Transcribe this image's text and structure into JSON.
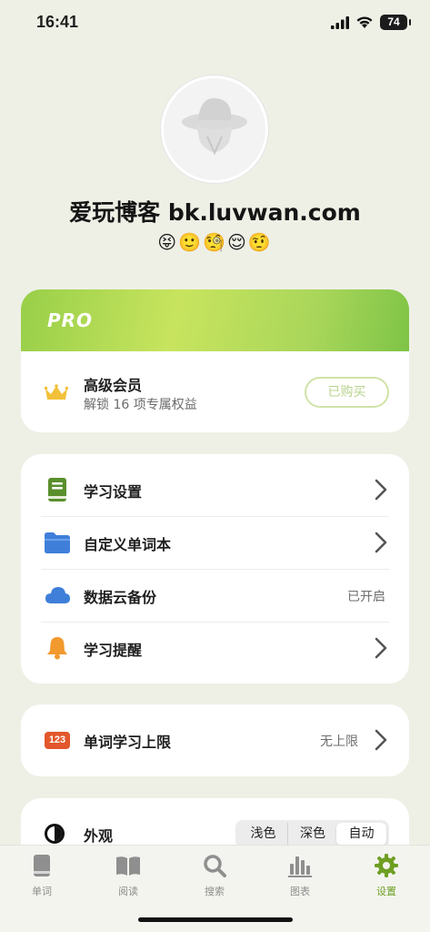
{
  "status_bar": {
    "time": "16:41",
    "battery": "74"
  },
  "profile": {
    "username": "爱玩博客 bk.luvwan.com",
    "emojis": "😝🙂🧐😌🤨"
  },
  "pro": {
    "label": "PRO",
    "member_title": "高级会员",
    "member_subtitle": "解锁 16 项专属权益",
    "bought_button": "已购买"
  },
  "settings": {
    "items": [
      {
        "label": "学习设置",
        "icon": "book-icon",
        "value": "",
        "chevron": true
      },
      {
        "label": "自定义单词本",
        "icon": "folder-icon",
        "value": "",
        "chevron": true
      },
      {
        "label": "数据云备份",
        "icon": "cloud-icon",
        "value": "已开启",
        "chevron": false
      },
      {
        "label": "学习提醒",
        "icon": "bell-icon",
        "value": "",
        "chevron": true
      }
    ]
  },
  "limit": {
    "badge": "123",
    "label": "单词学习上限",
    "value": "无上限"
  },
  "appearance": {
    "label": "外观",
    "options": [
      "浅色",
      "深色",
      "自动"
    ],
    "selected": "自动"
  },
  "tabbar": {
    "tabs": [
      {
        "label": "单词",
        "icon": "book-tab-icon"
      },
      {
        "label": "阅读",
        "icon": "open-book-icon"
      },
      {
        "label": "搜索",
        "icon": "search-icon"
      },
      {
        "label": "图表",
        "icon": "bar-chart-icon"
      },
      {
        "label": "设置",
        "icon": "gear-icon"
      }
    ],
    "active": "设置"
  },
  "colors": {
    "accent": "#7aab28",
    "background": "#eef0e6",
    "pro_gradient": "#b8dc52",
    "badge_red": "#e2572b",
    "folder_blue": "#3f7fd9",
    "bell_orange": "#f29a2e"
  }
}
